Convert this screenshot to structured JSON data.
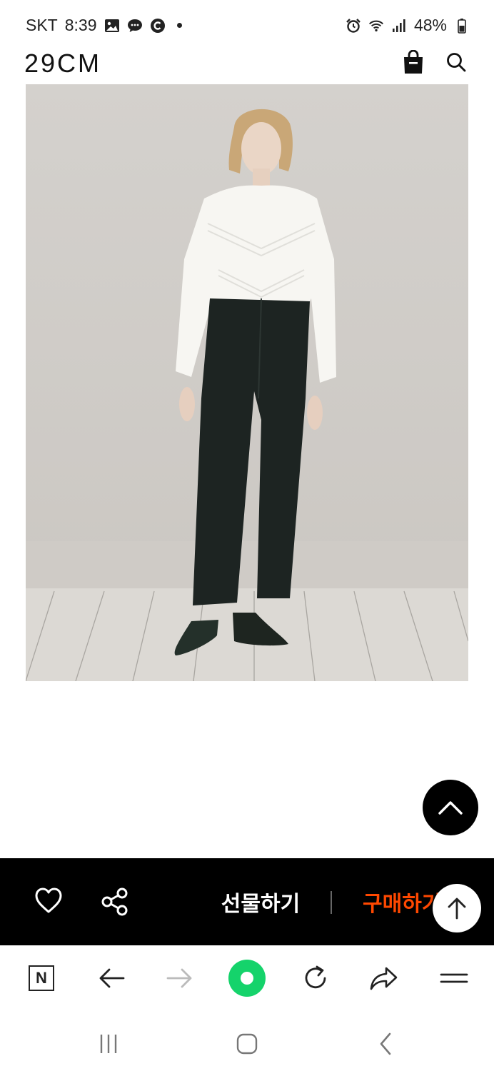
{
  "status_bar": {
    "carrier": "SKT",
    "time": "8:39",
    "battery": "48%"
  },
  "header": {
    "logo": "29CM"
  },
  "purchase_bar": {
    "gift_label": "선물하기",
    "buy_label": "구매하기"
  },
  "browser_bar": {
    "naver_label": "N"
  },
  "colors": {
    "accent_buy": "#ff4800",
    "green_home": "#15d36b",
    "bar_bg": "#000000"
  }
}
